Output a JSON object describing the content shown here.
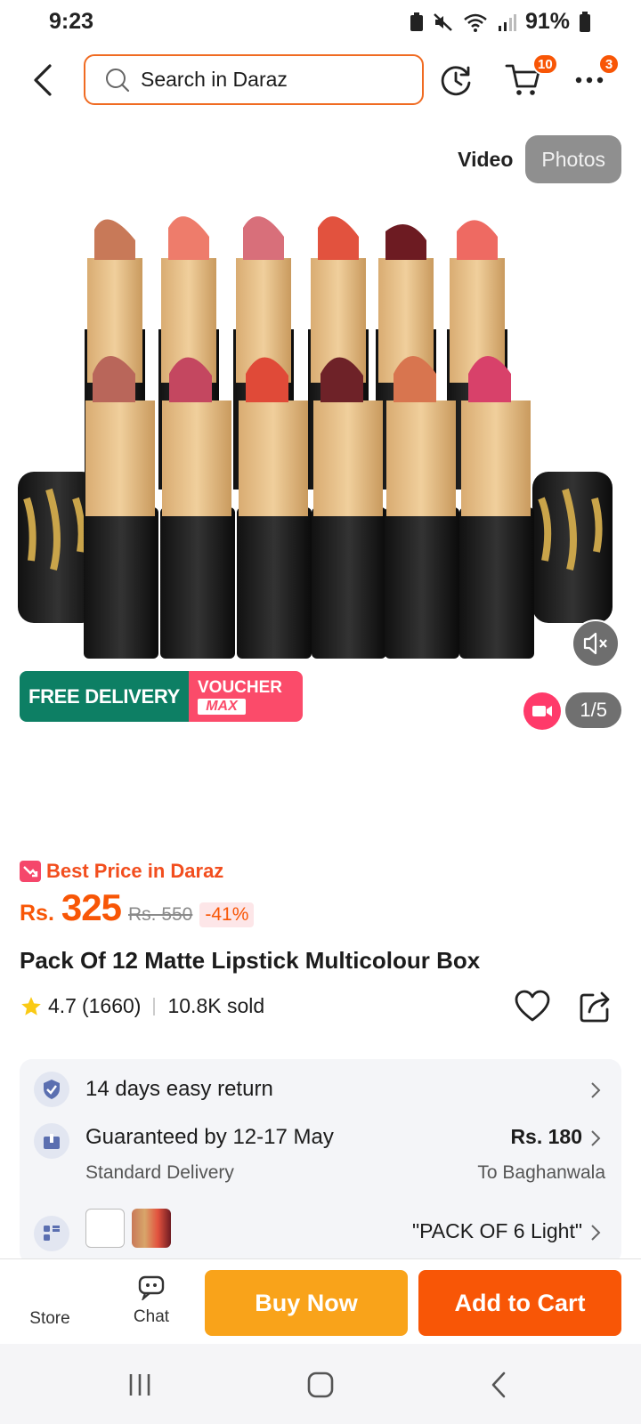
{
  "status_bar": {
    "time": "9:23",
    "battery": "91%"
  },
  "header": {
    "search_placeholder": "Search in Daraz",
    "cart_badge": "10",
    "more_badge": "3"
  },
  "gallery": {
    "tab_video": "Video",
    "tab_photos": "Photos",
    "active_tab": "Photos",
    "free_delivery": "FREE DELIVERY",
    "voucher_line1": "VOUCHER",
    "voucher_line2": "MAX",
    "page_counter": "1/5"
  },
  "price": {
    "best_price_label": "Best Price in Daraz",
    "currency": "Rs.",
    "current": "325",
    "original": "Rs. 550",
    "discount": "-41%"
  },
  "product": {
    "title": "Pack Of 12 Matte Lipstick Multicolour Box",
    "rating": "4.7",
    "rating_count": "(1660)",
    "sold": "10.8K sold"
  },
  "services": {
    "return_policy": "14 days easy return",
    "delivery_title": "Guaranteed by 12-17 May",
    "delivery_type": "Standard Delivery",
    "delivery_fee": "Rs. 180",
    "delivery_location": "To Baghanwala",
    "variant_text": "\"PACK OF 6  Light\""
  },
  "action_bar": {
    "store_label": "Store",
    "chat_label": "Chat",
    "buy_now": "Buy Now",
    "add_to_cart": "Add to Cart"
  },
  "colors": {
    "brand_orange": "#f85606",
    "buy_now_yellow": "#f9a31a",
    "free_delivery_green": "#0d7f64",
    "voucher_pink": "#fb4b6a"
  }
}
